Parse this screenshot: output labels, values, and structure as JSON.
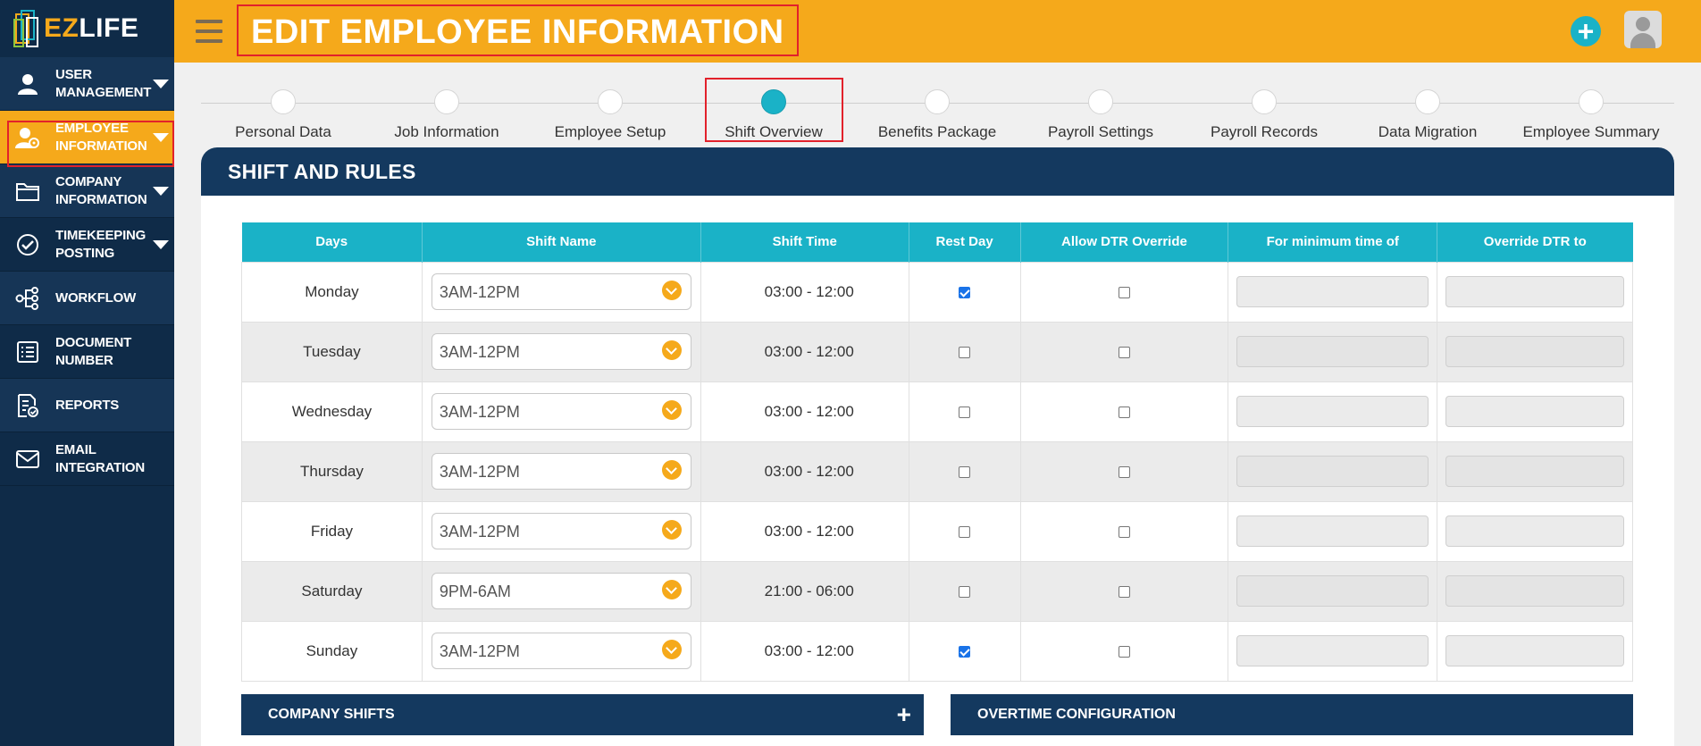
{
  "app": {
    "logo_ez": "EZ",
    "logo_life": "LIFE"
  },
  "sidebar": {
    "items": [
      {
        "label_1": "USER",
        "label_2": "MANAGEMENT",
        "icon": "user-icon"
      },
      {
        "label_1": "EMPLOYEE",
        "label_2": "INFORMATION",
        "icon": "employee-gear-icon"
      },
      {
        "label_1": "COMPANY",
        "label_2": "INFORMATION",
        "icon": "folder-icon"
      },
      {
        "label_1": "TIMEKEEPING",
        "label_2": "POSTING",
        "icon": "check-circle-icon"
      },
      {
        "label_1": "WORKFLOW",
        "label_2": "",
        "icon": "workflow-icon"
      },
      {
        "label_1": "DOCUMENT",
        "label_2": "NUMBER",
        "icon": "document-list-icon"
      },
      {
        "label_1": "REPORTS",
        "label_2": "",
        "icon": "report-icon"
      },
      {
        "label_1": "EMAIL",
        "label_2": "INTEGRATION",
        "icon": "mail-icon"
      }
    ]
  },
  "header": {
    "title": "EDIT EMPLOYEE INFORMATION",
    "add_label": "+"
  },
  "steps": [
    {
      "label": "Personal Data"
    },
    {
      "label": "Job Information"
    },
    {
      "label": "Employee Setup"
    },
    {
      "label": "Shift Overview"
    },
    {
      "label": "Benefits Package"
    },
    {
      "label": "Payroll Settings"
    },
    {
      "label": "Payroll Records"
    },
    {
      "label": "Data Migration"
    },
    {
      "label": "Employee Summary"
    }
  ],
  "panel": {
    "title": "SHIFT AND RULES"
  },
  "table": {
    "columns": [
      "Days",
      "Shift Name",
      "Shift Time",
      "Rest Day",
      "Allow DTR Override",
      "For minimum time of",
      "Override DTR to"
    ],
    "rows": [
      {
        "day": "Monday",
        "shift": "3AM-12PM",
        "time": "03:00 - 12:00",
        "rest_day": true,
        "allow_dtr": false
      },
      {
        "day": "Tuesday",
        "shift": "3AM-12PM",
        "time": "03:00 - 12:00",
        "rest_day": false,
        "allow_dtr": false
      },
      {
        "day": "Wednesday",
        "shift": "3AM-12PM",
        "time": "03:00 - 12:00",
        "rest_day": false,
        "allow_dtr": false
      },
      {
        "day": "Thursday",
        "shift": "3AM-12PM",
        "time": "03:00 - 12:00",
        "rest_day": false,
        "allow_dtr": false
      },
      {
        "day": "Friday",
        "shift": "3AM-12PM",
        "time": "03:00 - 12:00",
        "rest_day": false,
        "allow_dtr": false
      },
      {
        "day": "Saturday",
        "shift": "9PM-6AM",
        "time": "21:00 - 06:00",
        "rest_day": false,
        "allow_dtr": false
      },
      {
        "day": "Sunday",
        "shift": "3AM-12PM",
        "time": "03:00 - 12:00",
        "rest_day": true,
        "allow_dtr": false
      }
    ]
  },
  "sections": {
    "company_shifts": "COMPANY SHIFTS",
    "company_shifts_add": "+",
    "overtime": "OVERTIME CONFIGURATION"
  },
  "colors": {
    "sidebar_bg": "#0f2b48",
    "accent_orange": "#f5a91b",
    "accent_teal": "#1ab2c7",
    "panel_header": "#14395f",
    "highlight_outline": "#e2212b"
  }
}
